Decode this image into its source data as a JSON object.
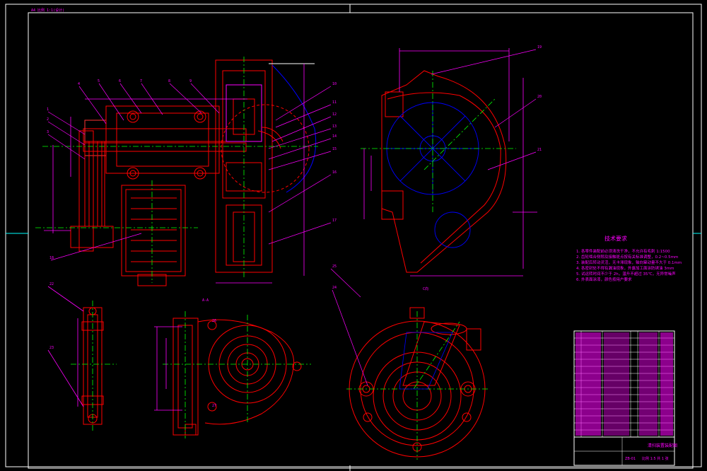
{
  "sheet": {
    "background": "#000000",
    "colors": {
      "outline": "#ff0000",
      "dimension": "#ff00ff",
      "center": "#00ff00",
      "hidden": "#0000ff",
      "frame": "#ffffff",
      "highlight": "#ffff00"
    }
  },
  "top_left_label": "A4 比例 1:1(设计)",
  "views": {
    "section_a_label": "A-A",
    "section_b_label": "B-B",
    "view_c_label": "C向"
  },
  "tech_requirements": {
    "title": "技术要求",
    "items": [
      "1. 各零件装配前必须清洗干净，不允许有毛刺 1:1500",
      "2. 齿轮啮合侧隙及接触斑点按有关标准调整，0.2~0.5mm",
      "3. 装配后转动灵活，无卡滞现象，轴向窜动量不大于 0.1mm",
      "4. 各密封处不得有漏油现象，外露加工面涂防锈油 3mm",
      "5. 试运转时间不少于 2h，温升不超过 35℃，无异常噪声",
      "6. 外表面涂漆，颜色按用户要求"
    ]
  },
  "title_block": {
    "drawing_name": "清扫装置装配图",
    "drawing_no": "ZB-01",
    "scale": "1:5",
    "footer": "比例 1:5  共 1 张"
  },
  "balloons": [
    "1",
    "2",
    "3",
    "4",
    "5",
    "6",
    "7",
    "8",
    "9",
    "10",
    "11",
    "12",
    "13",
    "14",
    "15",
    "16",
    "17",
    "18",
    "19",
    "20",
    "21",
    "22",
    "23",
    "24",
    "25",
    "26",
    "27"
  ]
}
